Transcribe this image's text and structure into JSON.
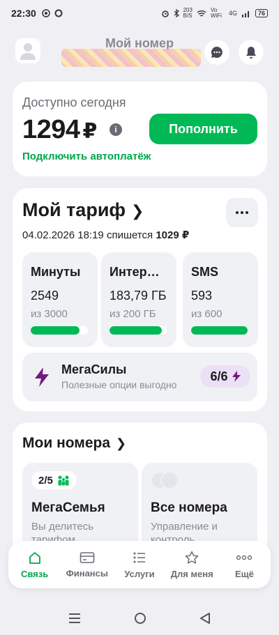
{
  "status_bar": {
    "time": "22:30",
    "net_speed": "203",
    "net_unit": "B/S",
    "vowifi": "Vo WiFi",
    "network": "4G",
    "battery": "76"
  },
  "header": {
    "title": "Мой номер"
  },
  "balance": {
    "label": "Доступно сегодня",
    "amount": "1294",
    "currency": "₽",
    "topup_label": "Пополнить",
    "autopay_label": "Подключить автоплатёж"
  },
  "tariff": {
    "title": "Мой тариф",
    "charge_date": "04.02.2026 18:19 спишется",
    "charge_amount": "1029 ₽",
    "resources": [
      {
        "title": "Минуты",
        "value": "2549",
        "total": "из 3000",
        "fraction": 0.85
      },
      {
        "title": "Интер…",
        "value": "183,79 ГБ",
        "total": "из 200 ГБ",
        "fraction": 0.92
      },
      {
        "title": "SMS",
        "value": "593",
        "total": "из 600",
        "fraction": 0.99
      }
    ],
    "megasily": {
      "title": "МегаСилы",
      "subtitle": "Полезные опции выгодно",
      "badge": "6/6"
    }
  },
  "numbers": {
    "title": "Мои номера",
    "family": {
      "badge": "2/5",
      "title": "МегаСемья",
      "subtitle": "Вы делитесь тарифом"
    },
    "all": {
      "title": "Все номера",
      "subtitle": "Управление и контроль"
    }
  },
  "bottom_nav": {
    "items": [
      {
        "label": "Связь",
        "icon": "home-icon"
      },
      {
        "label": "Финансы",
        "icon": "card-icon"
      },
      {
        "label": "Услуги",
        "icon": "services-icon"
      },
      {
        "label": "Для меня",
        "icon": "star-icon"
      },
      {
        "label": "Ещё",
        "icon": "more-icon"
      }
    ]
  },
  "colors": {
    "accent": "#00b956",
    "accent_text": "#00a64b",
    "mega_purple": "#731982",
    "background": "#f0f0f4"
  }
}
